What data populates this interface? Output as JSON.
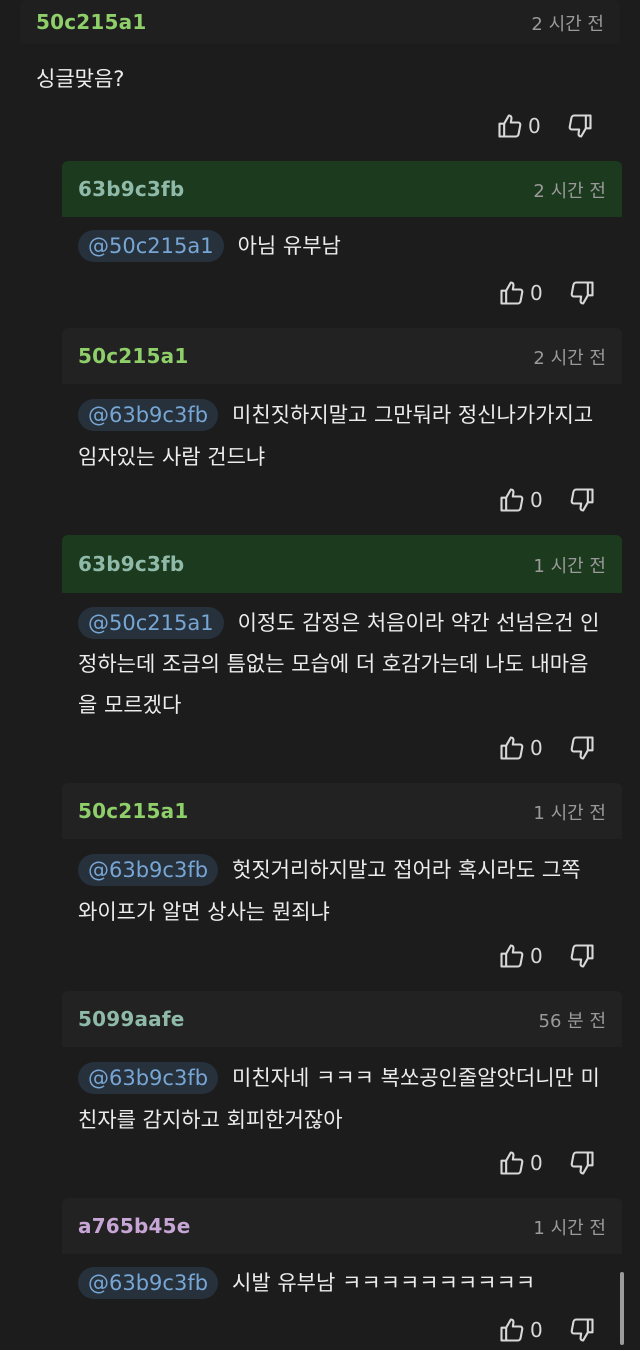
{
  "comments": [
    {
      "author": "50c215a1",
      "time": "2 시간 전",
      "mention": "",
      "text": "싱글맞음?",
      "likes": "0"
    },
    {
      "author": "63b9c3fb",
      "time": "2 시간 전",
      "mention": "@50c215a1",
      "text": "아님 유부남",
      "likes": "0"
    },
    {
      "author": "50c215a1",
      "time": "2 시간 전",
      "mention": "@63b9c3fb",
      "text": "미친짓하지말고 그만둬라 정신나가가지고 임자있는 사람 건드냐",
      "likes": "0"
    },
    {
      "author": "63b9c3fb",
      "time": "1 시간 전",
      "mention": "@50c215a1",
      "text": "이정도 감정은 처음이라 약간 선넘은건 인정하는데 조금의 틈없는 모습에 더 호감가는데 나도 내마음을 모르겠다",
      "likes": "0"
    },
    {
      "author": "50c215a1",
      "time": "1 시간 전",
      "mention": "@63b9c3fb",
      "text": "헛짓거리하지말고 접어라 혹시라도 그쪽 와이프가 알면 상사는 뭔죄냐",
      "likes": "0"
    },
    {
      "author": "5099aafe",
      "time": "56 분 전",
      "mention": "@63b9c3fb",
      "text": "미친자네 ㅋㅋㅋ 복쏘공인줄알앗더니만 미친자를 감지하고 회피한거잖아",
      "likes": "0"
    },
    {
      "author": "a765b45e",
      "time": "1 시간 전",
      "mention": "@63b9c3fb",
      "text": "시발 유부남 ㅋㅋㅋㅋㅋㅋㅋㅋㅋㅋ",
      "likes": "0"
    }
  ],
  "icons": {
    "like": "thumbs-up-icon",
    "dislike": "thumbs-down-icon"
  },
  "colors": {
    "background": "#1c1c1c",
    "op_header": "#1c3a1d",
    "mention_text": "#78a6d4",
    "author_green": "#8fcf6a"
  }
}
